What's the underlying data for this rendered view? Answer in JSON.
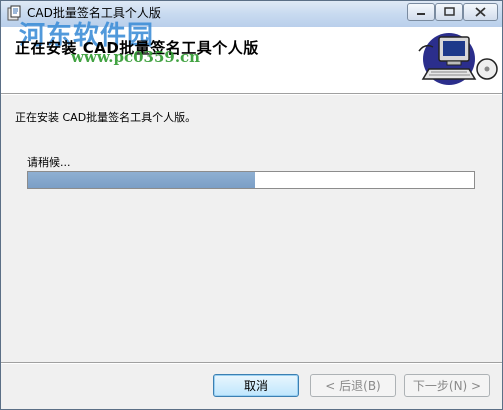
{
  "window": {
    "title": "CAD批量签名工具个人版",
    "minimize_glyph": "—",
    "maximize_glyph": "□",
    "close_glyph": "✕"
  },
  "header": {
    "title": "正在安装 CAD批量签名工具个人版",
    "watermark_name": "河东软件园",
    "watermark_url": "www.pc0359.cn"
  },
  "body": {
    "status": "正在安装 CAD批量签名工具个人版。",
    "wait_label": "请稍候...",
    "progress_fraction": 0.51
  },
  "buttons": {
    "cancel": "取消",
    "back": "< 后退(B)",
    "next": "下一步(N) >"
  },
  "colors": {
    "progress_fill": "#7b9ec6",
    "titlebar": "#c8daf0",
    "watermark_blue": "#3f8fd8",
    "watermark_green": "#2f9a2f"
  },
  "icons": [
    "installer-app-icon",
    "computer-setup-icon",
    "minimize-icon",
    "maximize-icon",
    "close-icon"
  ]
}
